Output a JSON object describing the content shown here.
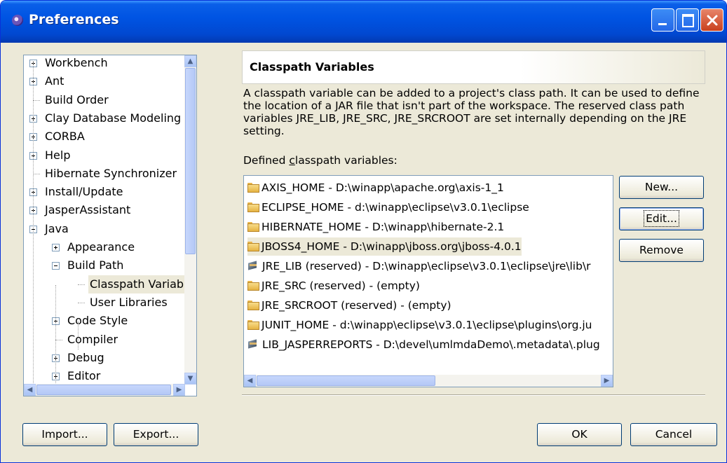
{
  "window": {
    "title": "Preferences"
  },
  "tree": {
    "items": [
      {
        "label": "Workbench",
        "expander": "plus",
        "level": 0
      },
      {
        "label": "Ant",
        "expander": "plus",
        "level": 0
      },
      {
        "label": "Build Order",
        "expander": "none",
        "level": 0
      },
      {
        "label": "Clay Database Modeling",
        "expander": "plus",
        "level": 0
      },
      {
        "label": "CORBA",
        "expander": "plus",
        "level": 0
      },
      {
        "label": "Help",
        "expander": "plus",
        "level": 0
      },
      {
        "label": "Hibernate Synchronizer",
        "expander": "none",
        "level": 0
      },
      {
        "label": "Install/Update",
        "expander": "plus",
        "level": 0
      },
      {
        "label": "JasperAssistant",
        "expander": "plus",
        "level": 0
      },
      {
        "label": "Java",
        "expander": "minus",
        "level": 0
      },
      {
        "label": "Appearance",
        "expander": "plus",
        "level": 1
      },
      {
        "label": "Build Path",
        "expander": "minus",
        "level": 1
      },
      {
        "label": "Classpath Variables",
        "expander": "none",
        "level": 2,
        "selected": true
      },
      {
        "label": "User Libraries",
        "expander": "none",
        "level": 2
      },
      {
        "label": "Code Style",
        "expander": "plus",
        "level": 1
      },
      {
        "label": "Compiler",
        "expander": "none",
        "level": 1
      },
      {
        "label": "Debug",
        "expander": "plus",
        "level": 1
      },
      {
        "label": "Editor",
        "expander": "plus",
        "level": 1
      }
    ]
  },
  "page": {
    "title": "Classpath Variables",
    "description": "A classpath variable can be added to a project's class path. It can be used to define the location of a JAR file that isn't part of the workspace. The reserved class path variables JRE_LIB, JRE_SRC, JRE_SRCROOT are set internally depending on the JRE setting.",
    "defined_label_prefix": "Defined ",
    "defined_label_mnemonic": "c",
    "defined_label_suffix": "lasspath variables:"
  },
  "variables": [
    {
      "icon": "folder",
      "text": "AXIS_HOME - D:\\winapp\\apache.org\\axis-1_1"
    },
    {
      "icon": "folder",
      "text": "ECLIPSE_HOME - d:\\winapp\\eclipse\\v3.0.1\\eclipse"
    },
    {
      "icon": "folder",
      "text": "HIBERNATE_HOME - D:\\winapp\\hibernate-2.1"
    },
    {
      "icon": "folder",
      "text": "JBOSS4_HOME - D:\\winapp\\jboss.org\\jboss-4.0.1",
      "selected": true
    },
    {
      "icon": "jar",
      "text": "JRE_LIB (reserved) - D:\\winapp\\eclipse\\v3.0.1\\eclipse\\jre\\lib\\r"
    },
    {
      "icon": "folder",
      "text": "JRE_SRC (reserved) - (empty)"
    },
    {
      "icon": "folder",
      "text": "JRE_SRCROOT (reserved) - (empty)"
    },
    {
      "icon": "folder",
      "text": "JUNIT_HOME - d:\\winapp\\eclipse\\v3.0.1\\eclipse\\plugins\\org.ju"
    },
    {
      "icon": "jar",
      "text": "LIB_JASPERREPORTS - D:\\devel\\umlmdaDemo\\.metadata\\.plug"
    }
  ],
  "buttons": {
    "new": "New...",
    "edit": "Edit...",
    "remove": "Remove",
    "import": "Import...",
    "export": "Export...",
    "ok": "OK",
    "cancel": "Cancel"
  }
}
